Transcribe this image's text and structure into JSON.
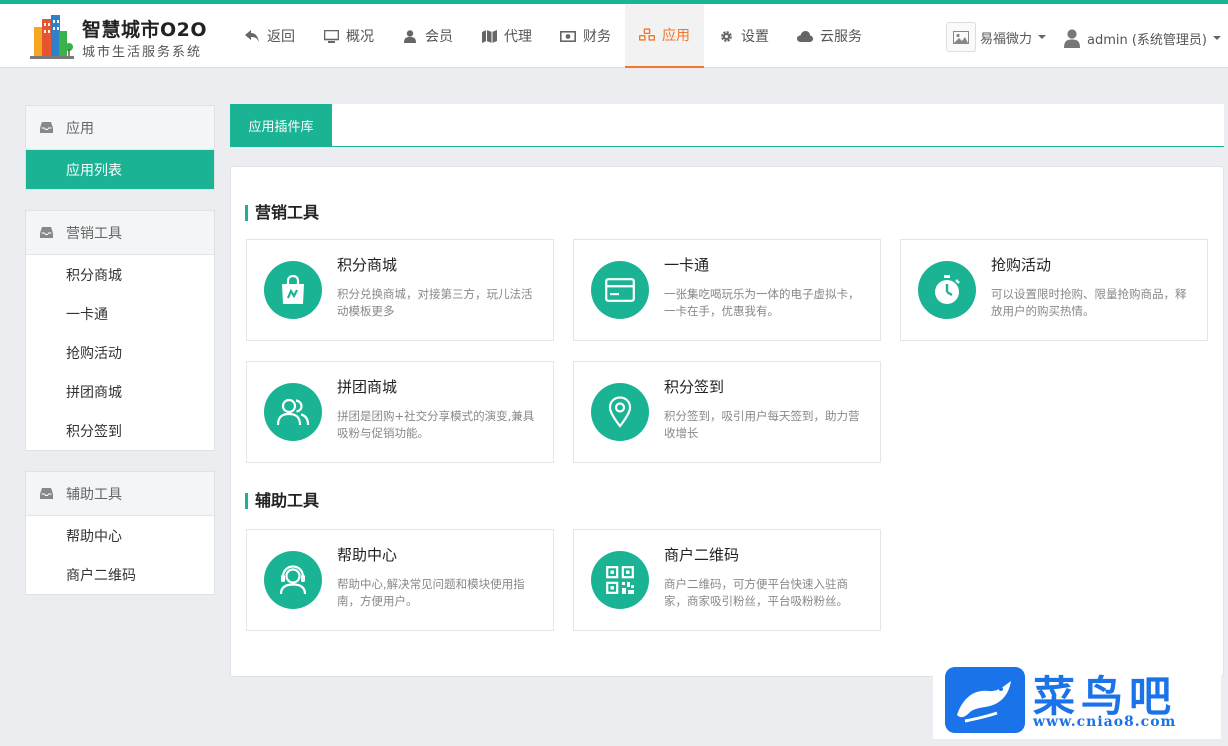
{
  "brand": {
    "title": "智慧城市O2O",
    "subtitle": "城市生活服务系统",
    "accent": "#1ab394",
    "active_nav": "#f4762a"
  },
  "nav": [
    {
      "label": "返回",
      "icon": "back-arrow-icon"
    },
    {
      "label": "概况",
      "icon": "monitor-icon"
    },
    {
      "label": "会员",
      "icon": "user-icon"
    },
    {
      "label": "代理",
      "icon": "map-icon"
    },
    {
      "label": "财务",
      "icon": "money-icon"
    },
    {
      "label": "应用",
      "icon": "cubes-icon",
      "active": true
    },
    {
      "label": "设置",
      "icon": "gear-icon"
    },
    {
      "label": "云服务",
      "icon": "cloud-icon"
    }
  ],
  "header_right": {
    "shop_name": "易福微力",
    "user_name": "admin (系统管理员)"
  },
  "sidebar": [
    {
      "title": "应用",
      "items": [
        {
          "label": "应用列表",
          "active": true
        }
      ]
    },
    {
      "title": "营销工具",
      "items": [
        {
          "label": "积分商城"
        },
        {
          "label": "一卡通"
        },
        {
          "label": "抢购活动"
        },
        {
          "label": "拼团商城"
        },
        {
          "label": "积分签到"
        }
      ]
    },
    {
      "title": "辅助工具",
      "items": [
        {
          "label": "帮助中心"
        },
        {
          "label": "商户二维码"
        }
      ]
    }
  ],
  "main": {
    "tab": "应用插件库",
    "sections": [
      {
        "title": "营销工具",
        "cards": [
          {
            "title": "积分商城",
            "desc": "积分兑换商城，对接第三方，玩儿法活动模板更多",
            "icon": "shopping-bag-icon"
          },
          {
            "title": "一卡通",
            "desc": "一张集吃喝玩乐为一体的电子虚拟卡，一卡在手，优惠我有。",
            "icon": "card-icon"
          },
          {
            "title": "抢购活动",
            "desc": "可以设置限时抢购、限量抢购商品，释放用户的购买热情。",
            "icon": "stopwatch-icon"
          },
          {
            "title": "拼团商城",
            "desc": "拼团是团购+社交分享模式的演变,兼具吸粉与促销功能。",
            "icon": "group-users-icon"
          },
          {
            "title": "积分签到",
            "desc": "积分签到，吸引用户每天签到，助力营收增长",
            "icon": "location-pin-icon"
          }
        ]
      },
      {
        "title": "辅助工具",
        "cards": [
          {
            "title": "帮助中心",
            "desc": "帮助中心,解决常见问题和模块使用指南，方便用户。",
            "icon": "headset-user-icon"
          },
          {
            "title": "商户二维码",
            "desc": "商户二维码，可方便平台快速入驻商家，商家吸引粉丝，平台吸粉粉丝。",
            "icon": "qrcode-icon"
          }
        ]
      }
    ]
  },
  "watermark": {
    "text": "菜鸟吧",
    "url": "www.cniao8.com"
  }
}
